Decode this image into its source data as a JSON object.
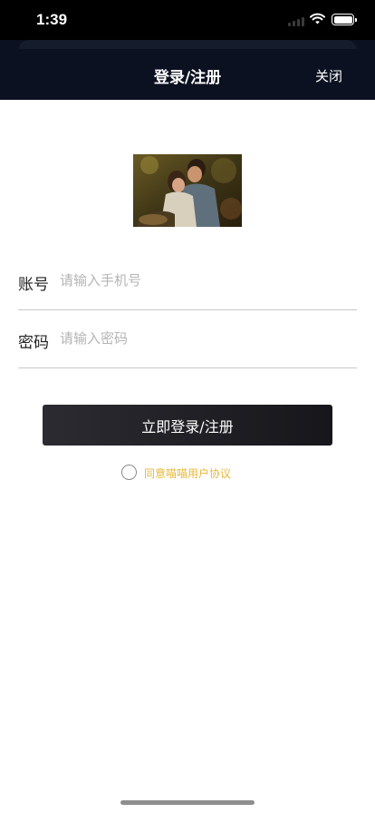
{
  "status_bar": {
    "time": "1:39",
    "icons": [
      "signal-icon",
      "wifi-icon",
      "battery-icon"
    ]
  },
  "nav": {
    "title": "登录/注册",
    "close_label": "关闭"
  },
  "logo": {
    "icon": "movie-poster-image"
  },
  "form": {
    "account_label": "账号",
    "account_placeholder": "请输入手机号",
    "account_value": "",
    "password_label": "密码",
    "password_placeholder": "请输入密码",
    "password_value": ""
  },
  "login_button_label": "立即登录/注册",
  "agreement": {
    "text": "同意喵喵用户协议",
    "checked": false
  },
  "colors": {
    "nav_background": "#0b1120",
    "button_background": "#1f1f24",
    "agreement_text": "#e6b83a"
  }
}
